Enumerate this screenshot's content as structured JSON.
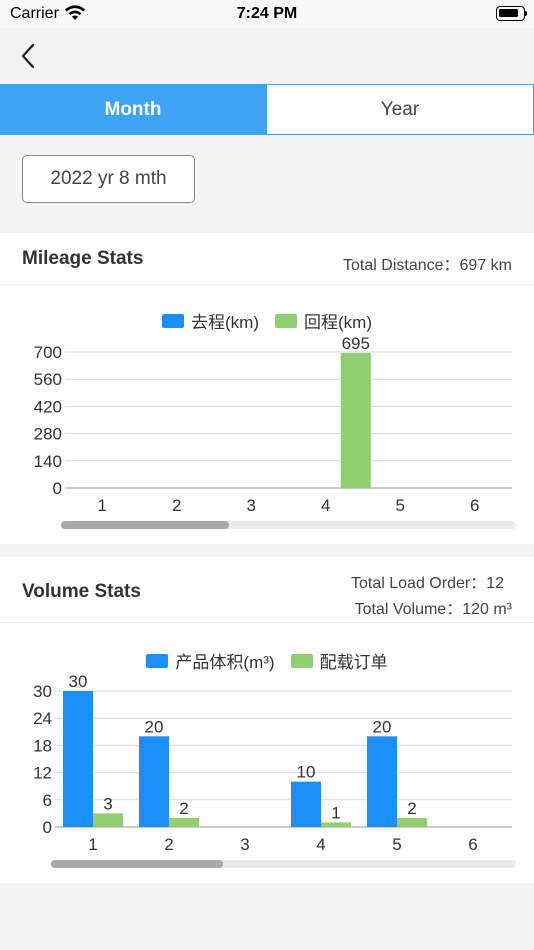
{
  "status_bar": {
    "carrier": "Carrier",
    "time": "7:24 PM"
  },
  "tabs": [
    {
      "label": "Month",
      "active": true
    },
    {
      "label": "Year",
      "active": false
    }
  ],
  "date_selector": {
    "label": "2022 yr 8 mth"
  },
  "mileage": {
    "title": "Mileage Stats",
    "total_label": "Total Distance：697 km",
    "legend": [
      {
        "label": "去程(km)",
        "color": "#1c8ff7"
      },
      {
        "label": "回程(km)",
        "color": "#92cd71"
      }
    ],
    "scroll": {
      "visible_fraction": 0.37,
      "position": 0
    }
  },
  "volume": {
    "title": "Volume Stats",
    "total_orders_label": "Total Load Order：12",
    "total_volume_label": "Total Volume：120 m³",
    "legend": [
      {
        "label": "产品体积(m³)",
        "color": "#1c8ff7"
      },
      {
        "label": "配载订单",
        "color": "#92cd71"
      }
    ],
    "scroll": {
      "visible_fraction": 0.37,
      "position": 0
    }
  },
  "chart_data": [
    {
      "type": "bar",
      "categories": [
        "1",
        "2",
        "3",
        "4",
        "5",
        "6"
      ],
      "series": [
        {
          "name": "去程(km)",
          "values": [
            0,
            0,
            0,
            0,
            0,
            0
          ],
          "color": "#1c8ff7"
        },
        {
          "name": "回程(km)",
          "values": [
            0,
            0,
            0,
            695,
            0,
            0
          ],
          "color": "#92cd71"
        }
      ],
      "yticks": [
        0,
        140,
        280,
        420,
        560,
        700
      ],
      "ylim": [
        0,
        700
      ],
      "grid": true,
      "legend": "top"
    },
    {
      "type": "bar",
      "categories": [
        "1",
        "2",
        "3",
        "4",
        "5",
        "6"
      ],
      "series": [
        {
          "name": "产品体积(m³)",
          "values": [
            30,
            20,
            0,
            10,
            20,
            0
          ],
          "color": "#1c8ff7"
        },
        {
          "name": "配载订单",
          "values": [
            3,
            2,
            0,
            1,
            2,
            0
          ],
          "color": "#92cd71"
        }
      ],
      "yticks": [
        0,
        6,
        12,
        18,
        24,
        30
      ],
      "ylim": [
        0,
        30
      ],
      "grid": true,
      "legend": "top"
    }
  ]
}
